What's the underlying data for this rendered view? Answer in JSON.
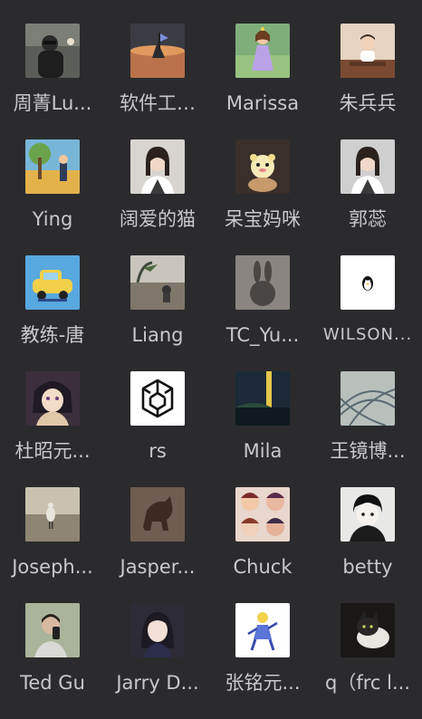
{
  "members": [
    {
      "name": "周菁Lu...",
      "avatar_icon": "person-dark-photo-icon",
      "bg": "#5b5e58"
    },
    {
      "name": "软件工…",
      "avatar_icon": "sunset-boat-photo-icon",
      "bg": "#6a4a3a"
    },
    {
      "name": "Marissa",
      "avatar_icon": "princess-cartoon-icon",
      "bg": "#7fae7b"
    },
    {
      "name": "朱兵兵",
      "avatar_icon": "child-photo-icon",
      "bg": "#e6d3c1"
    },
    {
      "name": "Ying",
      "avatar_icon": "cartoon-scene-icon",
      "bg": "#d9a33a"
    },
    {
      "name": "阔爱的猫",
      "avatar_icon": "woman-portrait-icon",
      "bg": "#d8d4cf"
    },
    {
      "name": "呆宝妈咪",
      "avatar_icon": "plush-toy-photo-icon",
      "bg": "#3a2f2a"
    },
    {
      "name": "郭蕊",
      "avatar_icon": "woman-portrait-icon",
      "bg": "#cfcfcf"
    },
    {
      "name": "教练-唐",
      "avatar_icon": "car-cartoon-icon",
      "bg": "#58a9e0"
    },
    {
      "name": "Liang",
      "avatar_icon": "beach-photo-icon",
      "bg": "#8c8476"
    },
    {
      "name": "TC_Yu...",
      "avatar_icon": "shadow-bunny-icon",
      "bg": "#6e6a67"
    },
    {
      "name": "WILSON...",
      "avatar_icon": "penguin-logo-icon",
      "bg": "#ffffff"
    },
    {
      "name": "杜昭元...",
      "avatar_icon": "anime-character-icon",
      "bg": "#3b2f3c"
    },
    {
      "name": "rs",
      "avatar_icon": "hexagon-logo-icon",
      "bg": "#ffffff"
    },
    {
      "name": "Mila",
      "avatar_icon": "sunset-landscape-icon",
      "bg": "#2c3a44"
    },
    {
      "name": "王镜博...",
      "avatar_icon": "abstract-lines-icon",
      "bg": "#b9c0bc"
    },
    {
      "name": "Joseph...",
      "avatar_icon": "bird-photo-icon",
      "bg": "#9a9283"
    },
    {
      "name": "Jasper...",
      "avatar_icon": "horse-statue-icon",
      "bg": "#5a4a40"
    },
    {
      "name": "Chuck",
      "avatar_icon": "anime-collage-icon",
      "bg": "#e9d6cc"
    },
    {
      "name": "betty",
      "avatar_icon": "manga-boy-icon",
      "bg": "#e8e8e6"
    },
    {
      "name": "Ted Gu",
      "avatar_icon": "selfie-photo-icon",
      "bg": "#c6c4b2"
    },
    {
      "name": "Jarry D...",
      "avatar_icon": "girl-portrait-icon",
      "bg": "#2d2b35"
    },
    {
      "name": "张铭元...",
      "avatar_icon": "sketch-figure-icon",
      "bg": "#ffffff"
    },
    {
      "name": "q（frc l...",
      "avatar_icon": "cat-photo-icon",
      "bg": "#2a2626"
    }
  ]
}
